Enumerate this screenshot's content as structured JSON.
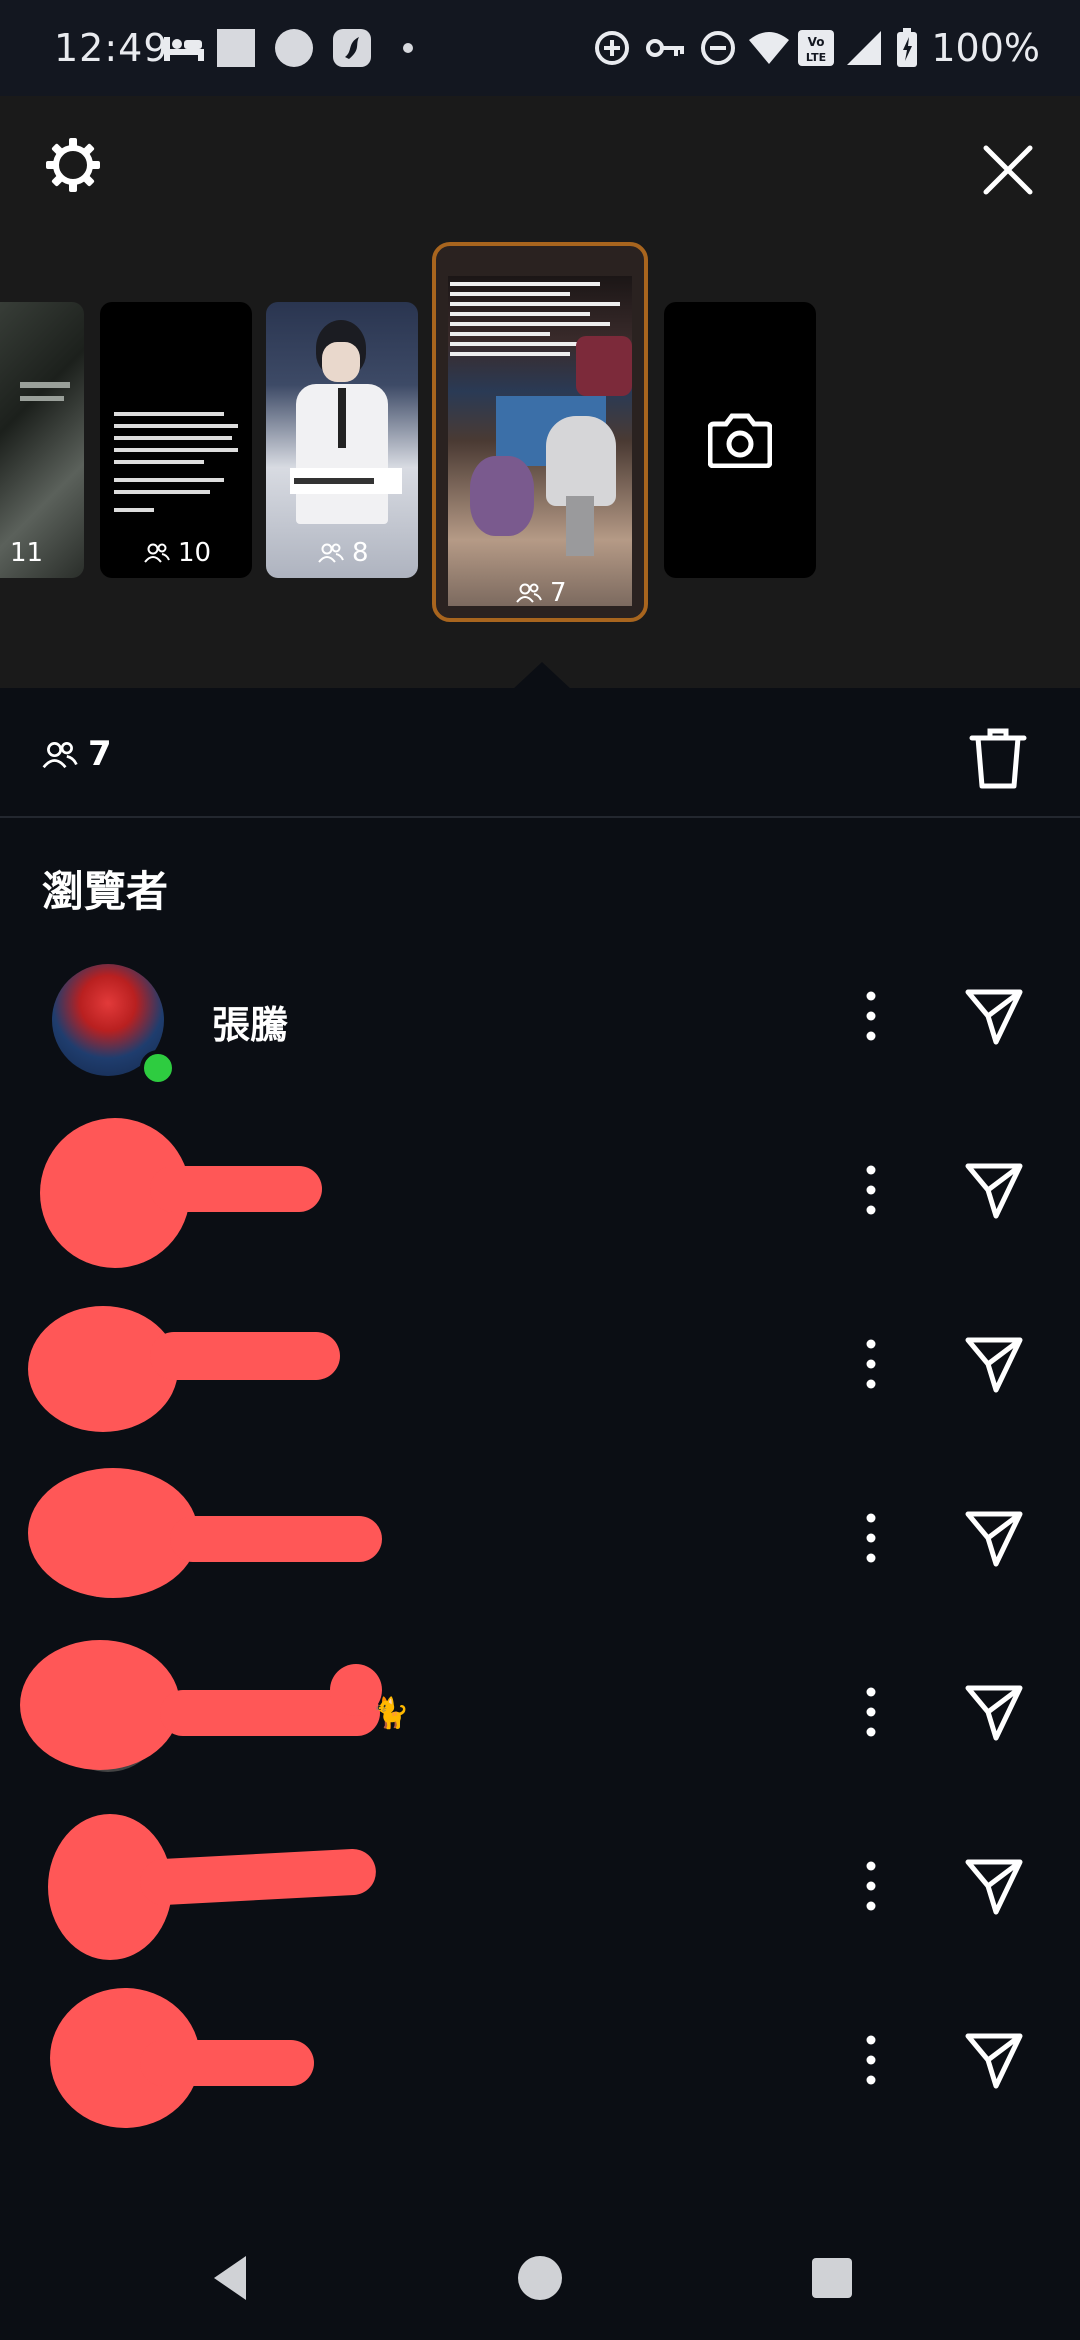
{
  "status_bar": {
    "time": "12:49",
    "battery_text": "100%",
    "icons": [
      "bed-icon",
      "square-app-icon",
      "circle-app-icon",
      "swift-icon",
      "dot-icon",
      "data-saver-icon",
      "vpn-key-icon",
      "do-not-disturb-icon",
      "wifi-icon",
      "volte-icon",
      "signal-icon",
      "battery-icon"
    ]
  },
  "stories": {
    "thumbnails": [
      {
        "count": "11"
      },
      {
        "count": "10"
      },
      {
        "count": "8"
      },
      {
        "count": "7"
      }
    ]
  },
  "viewer_summary": {
    "count": "7"
  },
  "section_title": "瀏覽者",
  "viewers": [
    {
      "name": "張騰",
      "online": true
    },
    {
      "name": "",
      "online": false
    },
    {
      "name": "",
      "online": false
    },
    {
      "name": "",
      "online": false
    },
    {
      "name": "",
      "online": false
    },
    {
      "name": "",
      "online": false
    },
    {
      "name": "",
      "online": false
    }
  ],
  "colors": {
    "background": "#0b0e14",
    "story_bar": "#1a1a1a",
    "active_border": "#a8651e",
    "online_dot": "#2ecc40",
    "redaction": "#ff5757"
  }
}
